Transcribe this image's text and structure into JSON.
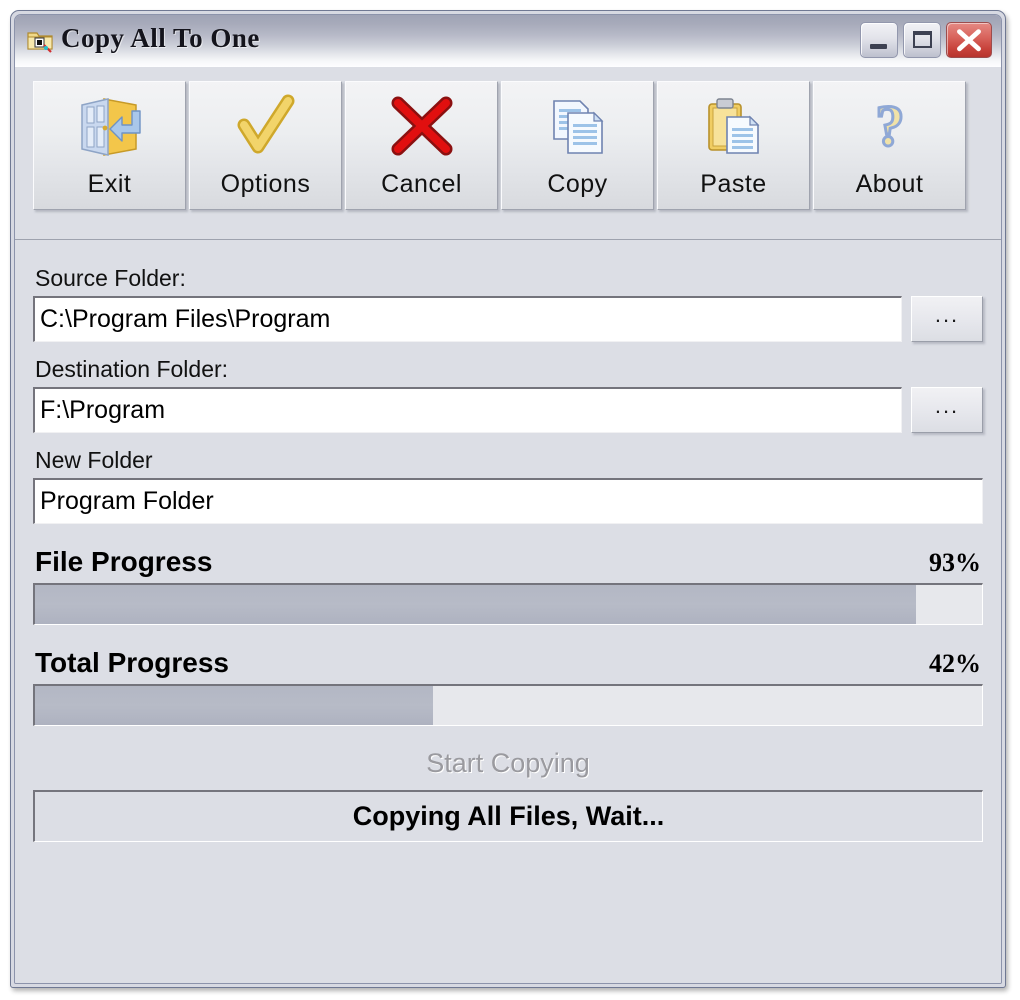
{
  "window": {
    "title": "Copy All To One",
    "icon": "copy-folder-icon",
    "controls": {
      "minimize_label": "minimize-icon",
      "maximize_label": "maximize-icon",
      "close_label": "close-icon"
    },
    "accent_close": "#c8433c",
    "border_color": "#6f7893",
    "titlebar_top": "#9fa3b5",
    "face_color": "#dcdee5"
  },
  "toolbar": {
    "buttons": [
      {
        "label": "Exit",
        "icon": "exit-door-icon"
      },
      {
        "label": "Options",
        "icon": "yellow-check-icon"
      },
      {
        "label": "Cancel",
        "icon": "red-x-icon"
      },
      {
        "label": "Copy",
        "icon": "copy-pages-icon"
      },
      {
        "label": "Paste",
        "icon": "clipboard-paste-icon"
      },
      {
        "label": "About",
        "icon": "question-mark-icon"
      }
    ]
  },
  "form": {
    "source": {
      "label": "Source Folder:",
      "value": "C:\\Program Files\\Program",
      "browse_label": "..."
    },
    "destination": {
      "label": "Destination Folder:",
      "value": "F:\\Program",
      "browse_label": "..."
    },
    "new_folder": {
      "label": "New Folder",
      "value": "Program Folder"
    }
  },
  "progress": {
    "file": {
      "label": "File Progress",
      "percent_label": "93%",
      "percent": 93,
      "fill_color": "#b3b7c4"
    },
    "total": {
      "label": "Total Progress",
      "percent_label": "42%",
      "percent": 42,
      "fill_color": "#b3b7c4"
    }
  },
  "actions": {
    "start_label": "Start Copying",
    "start_disabled": true
  },
  "status": {
    "message": "Copying All Files, Wait..."
  }
}
